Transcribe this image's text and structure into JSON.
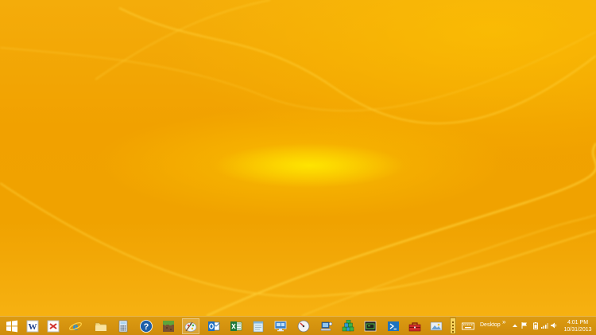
{
  "os": "Windows 8.1",
  "colors": {
    "wallpaper": "#f0a200",
    "taskbar": "#d4910e",
    "text": "#ffffff"
  },
  "taskbar": {
    "pinned": [
      {
        "name": "start-button",
        "icon": "windows-logo-icon"
      },
      {
        "name": "word-button",
        "icon": "word-w-icon",
        "glyph": "W"
      },
      {
        "name": "xmind-button",
        "icon": "xmind-icon"
      },
      {
        "name": "internet-explorer-button",
        "icon": "internet-explorer-icon",
        "glyph": "e"
      },
      {
        "name": "file-explorer-button",
        "icon": "folder-icon"
      },
      {
        "name": "calculator-button",
        "icon": "calculator-icon"
      },
      {
        "name": "help-button",
        "icon": "help-question-icon",
        "glyph": "?"
      },
      {
        "name": "minecraft-button",
        "icon": "minecraft-block-icon"
      },
      {
        "name": "paint-button",
        "icon": "paint-palette-icon"
      },
      {
        "name": "outlook-button",
        "icon": "outlook-icon"
      },
      {
        "name": "excel-button",
        "icon": "excel-icon"
      },
      {
        "name": "notepad-button",
        "icon": "notepad-icon"
      },
      {
        "name": "remote-desktop-button",
        "icon": "remote-desktop-icon"
      },
      {
        "name": "speedometer-button",
        "icon": "speedometer-icon"
      },
      {
        "name": "network-computer-button",
        "icon": "network-computer-icon"
      },
      {
        "name": "registry-editor-button",
        "icon": "registry-cubes-icon"
      },
      {
        "name": "terminal-button",
        "icon": "terminal-icon"
      },
      {
        "name": "powershell-button",
        "icon": "powershell-icon"
      },
      {
        "name": "toolbox-button",
        "icon": "toolbox-icon"
      },
      {
        "name": "photo-viewer-button",
        "icon": "photo-viewer-icon"
      }
    ],
    "toolbar_label": "Desktop",
    "toolbar_chevron": "»",
    "tray": {
      "icons": [
        "show-hidden-icons-icon",
        "action-center-flag-icon",
        "battery-icon",
        "network-signal-icon",
        "volume-icon"
      ],
      "time": "4:01 PM",
      "date": "10/31/2013"
    }
  }
}
